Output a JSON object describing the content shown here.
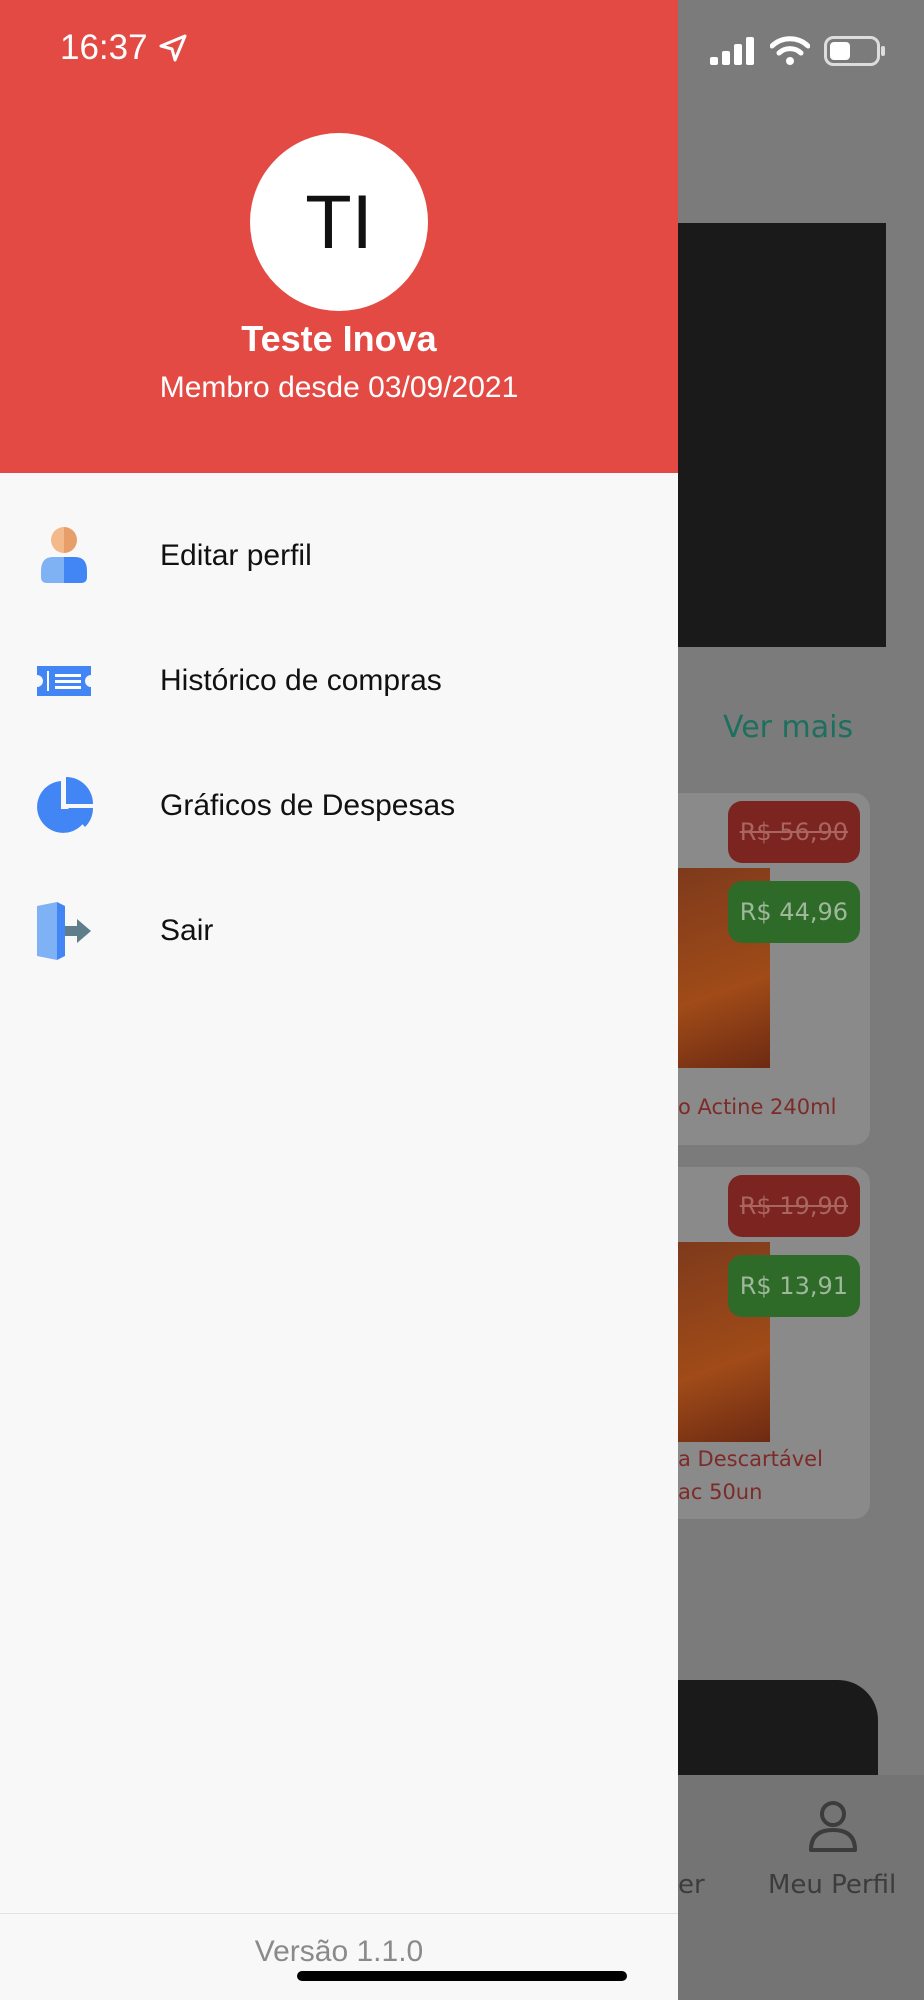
{
  "status_bar": {
    "time": "16:37"
  },
  "drawer": {
    "avatar_initials": "TI",
    "user_name": "Teste Inova",
    "member_since": "Membro desde 03/09/2021",
    "menu": [
      {
        "label": "Editar perfil",
        "icon": "user-icon"
      },
      {
        "label": "Histórico de compras",
        "icon": "ticket-icon"
      },
      {
        "label": "Gráficos de Despesas",
        "icon": "pie-chart-icon"
      },
      {
        "label": "Sair",
        "icon": "logout-door-icon"
      }
    ],
    "version": "Versão 1.1.0"
  },
  "background": {
    "see_more": "Ver mais",
    "products": [
      {
        "old_price": "R$ 56,90",
        "new_price": "R$ 44,96",
        "name": "o Actine 240ml"
      },
      {
        "old_price": "R$ 19,90",
        "new_price": "R$ 13,91",
        "name_line1": "a Descartável",
        "name_line2": "ac 50un"
      }
    ],
    "tabs": {
      "partial_label": "er",
      "profile_label": "Meu Perfil"
    }
  },
  "colors": {
    "header": "#e34a44",
    "icon_blue": "#4285f4",
    "icon_light_blue": "#7fb1f5"
  }
}
